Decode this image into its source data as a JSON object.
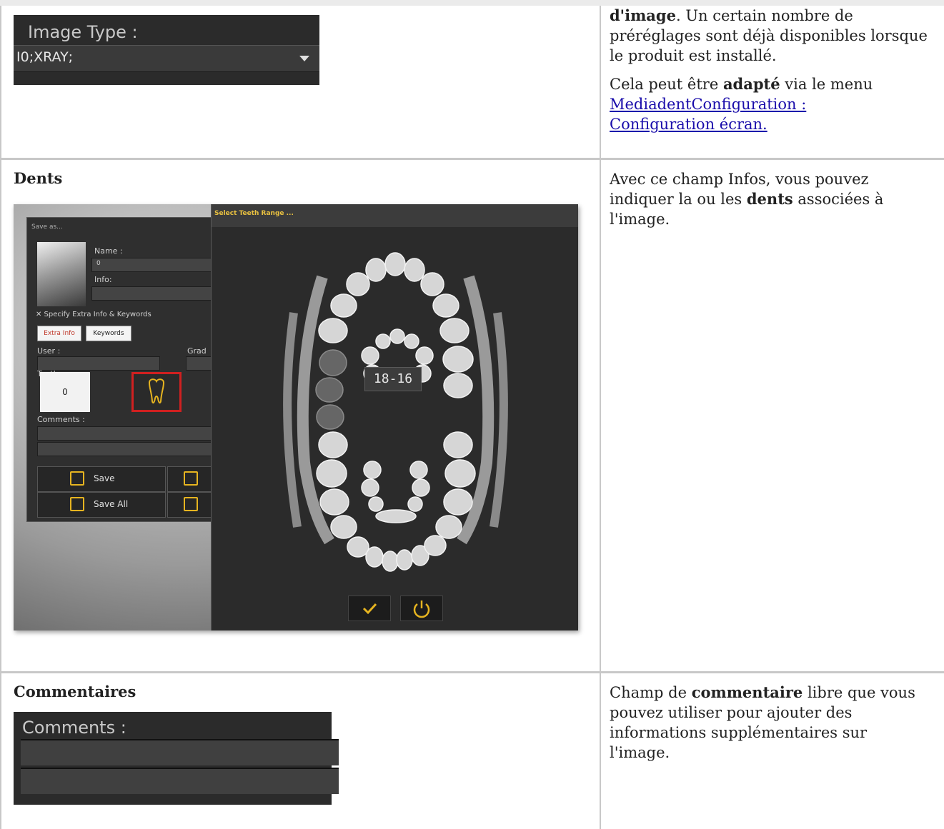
{
  "row1": {
    "image_type_label": "Image Type :",
    "image_type_value": "I0;XRAY;",
    "desc_bold": "d'image",
    "desc_rest": ". Un certain nombre de préréglages sont déjà disponibles lorsque le produit est installé.",
    "p2_before": "Cela peut être ",
    "p2_bold": "adapté",
    "p2_after": " via le menu",
    "p2_link": "MediadentConfiguration : Configuration écran."
  },
  "row2": {
    "heading": "Dents",
    "desc_before": "Avec ce champ Infos, vous pouvez indiquer la ou les ",
    "desc_bold": "dents",
    "desc_after": " associées à l'image.",
    "save_as": {
      "title": "Save as...",
      "name_label": "Name :",
      "name_value": "0",
      "info_label": "Info:",
      "extra_check": "✕ Specify Extra Info & Keywords",
      "extra_info_btn": "Extra Info",
      "keywords_btn": "Keywords",
      "user_label": "User :",
      "grade_label": "Grad",
      "teeth_label": "Teeth :",
      "teeth_value": "0",
      "comments_label": "Comments :",
      "save_btn": "Save",
      "save_all_btn": "Save All"
    },
    "teeth_dialog": {
      "title": "Select Teeth Range ...",
      "range": "18-16"
    }
  },
  "row3": {
    "heading": "Commentaires",
    "comments_label": "Comments :",
    "desc_before": "Champ de ",
    "desc_bold": "commentaire",
    "desc_after": " libre que vous pouvez utiliser pour ajouter des informations supplémentaires sur l'image."
  }
}
